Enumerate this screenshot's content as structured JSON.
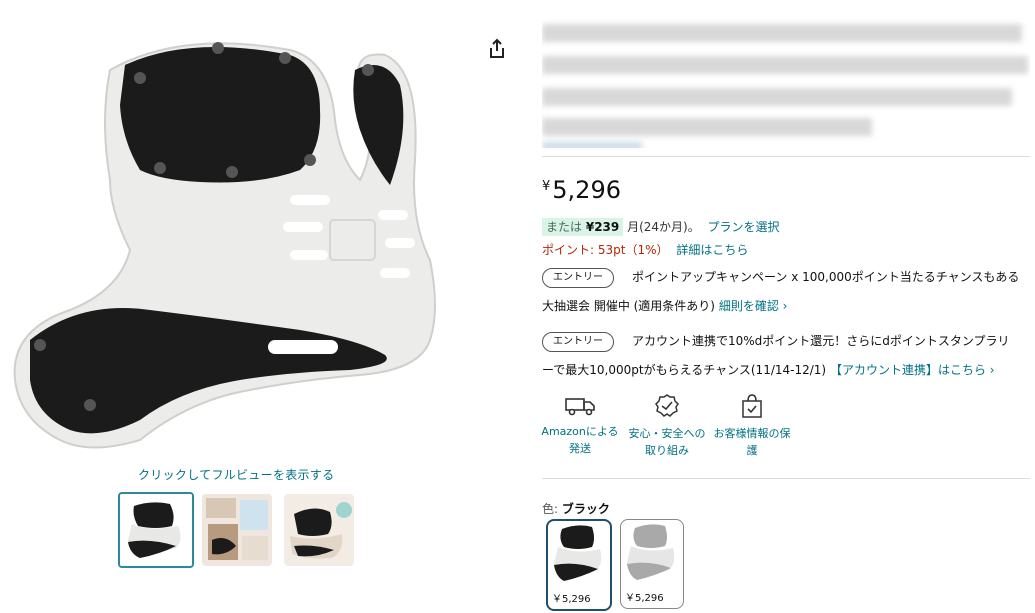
{
  "gallery": {
    "fullview_label": "クリックしてフルビューを表示する",
    "thumb_count": 3
  },
  "price": {
    "currency": "¥",
    "amount": "5,296"
  },
  "installment": {
    "prefix": "または",
    "amount": "¥239",
    "suffix": "月(24か月)。",
    "plan_link": "プランを選択"
  },
  "points": {
    "text": "ポイント: 53pt（1%）",
    "details_link": "詳細はこちら"
  },
  "promo1": {
    "tag": "エントリー",
    "line1": "ポイントアップキャンペーン x 100,000ポイント当たるチャンスもある",
    "line2": "大抽選会 開催中 (適用条件あり)",
    "link": "細則を確認 ›"
  },
  "promo2": {
    "tag": "エントリー",
    "line1": "アカウント連携で10%dポイント還元！さらにdポイントスタンプラリ",
    "line2": "ーで最大10,000ptがもらえるチャンス(11/14-12/1)",
    "link": "【アカウント連携】はこちら ›"
  },
  "features": [
    {
      "label": "Amazonによる発送",
      "icon": "truck-icon"
    },
    {
      "label": "安心・安全への取り組み",
      "icon": "badge-check-icon"
    },
    {
      "label": "お客様情報の保護",
      "icon": "secure-bag-icon"
    }
  ],
  "color": {
    "label": "色:",
    "selected": "ブラック",
    "options": [
      {
        "price": "￥5,296",
        "shade": "black"
      },
      {
        "price": "￥5,296",
        "shade": "gray"
      }
    ]
  },
  "colors": {
    "link": "#007185",
    "price_red": "#b12704",
    "badge_green_bg": "#d9f3e7"
  }
}
